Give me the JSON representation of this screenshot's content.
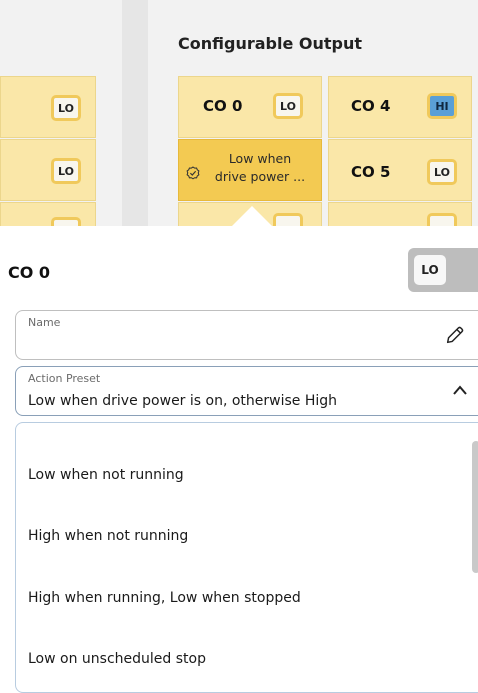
{
  "section": {
    "title": "Configurable Output"
  },
  "grid": {
    "left_badges": [
      "LO",
      "LO",
      "LO"
    ],
    "co0": {
      "name": "CO 0",
      "badge": "LO"
    },
    "co0_desc": {
      "line1": "Low when",
      "line2": "drive power ..."
    },
    "co4": {
      "name": "CO 4",
      "badge": "HI"
    },
    "co5": {
      "name": "CO 5",
      "badge": "LO"
    }
  },
  "popup": {
    "title": "CO 0",
    "toggle_label": "LO",
    "name_field": {
      "label": "Name",
      "value": ""
    },
    "action_preset": {
      "label": "Action Preset",
      "value": "Low when drive power is on, otherwise High"
    },
    "options": [
      "Low when not running",
      "High when not running",
      "High when running, Low when stopped",
      "Low on unscheduled stop"
    ]
  },
  "colors": {
    "cell": "#fae7a8",
    "cell_active": "#f3ca52",
    "badge_hi": "#5a9fd6",
    "badge_border": "#f0c95b"
  },
  "icons": {
    "edit": "pencil-icon",
    "chevron": "chevron-up-icon",
    "selected": "check-badge-icon"
  }
}
